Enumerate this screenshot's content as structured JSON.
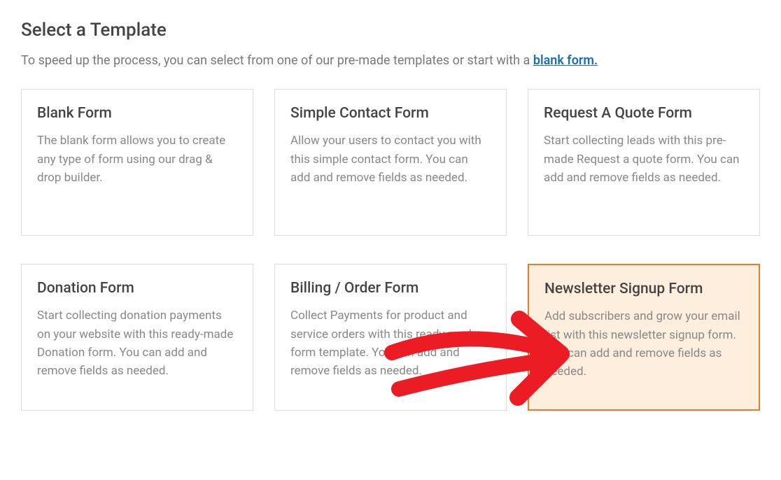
{
  "page": {
    "title": "Select a Template",
    "subtext_prefix": "To speed up the process, you can select from one of our pre-made templates or start with a ",
    "subtext_link": "blank form."
  },
  "templates": [
    {
      "title": "Blank Form",
      "desc": "The blank form allows you to create any type of form using our drag & drop builder.",
      "highlight": false
    },
    {
      "title": "Simple Contact Form",
      "desc": "Allow your users to contact you with this simple contact form. You can add and remove fields as needed.",
      "highlight": false
    },
    {
      "title": "Request A Quote Form",
      "desc": "Start collecting leads with this pre-made Request a quote form. You can add and remove fields as needed.",
      "highlight": false
    },
    {
      "title": "Donation Form",
      "desc": "Start collecting donation payments on your website with this ready-made Donation form. You can add and remove fields as needed.",
      "highlight": false
    },
    {
      "title": "Billing / Order Form",
      "desc": "Collect Payments for product and service orders with this ready-made form template. You can add and remove fields as needed.",
      "highlight": false
    },
    {
      "title": "Newsletter Signup Form",
      "desc": "Add subscribers and grow your email list with this newsletter signup form. You can add and remove fields as needed.",
      "highlight": true
    }
  ]
}
